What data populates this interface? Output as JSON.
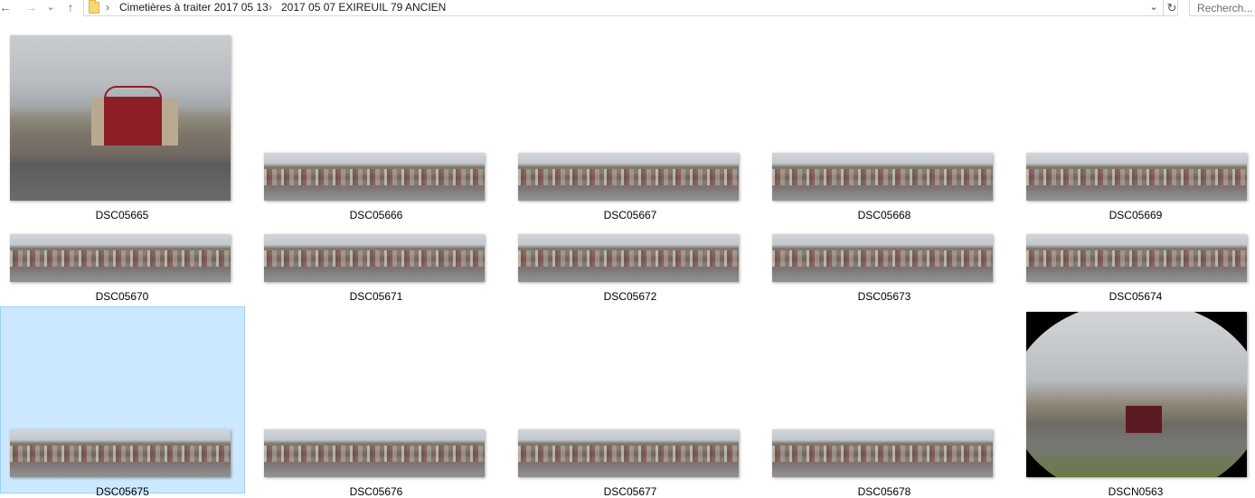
{
  "toolbar": {
    "back_icon": "←",
    "forward_icon": "→",
    "history_icon": "⌄",
    "up_icon": "↑",
    "crumb_sep": "›",
    "breadcrumb": [
      "Cimetières à traiter 2017 05 13",
      "2017 05 07 EXIREUIL 79 ANCIEN"
    ],
    "dropdown_icon": "⌄",
    "refresh_icon": "↻",
    "search_placeholder": "Recherch..."
  },
  "items": [
    {
      "name": "DSC05665",
      "kind": "photo-gate"
    },
    {
      "name": "DSC05666",
      "kind": "pano"
    },
    {
      "name": "DSC05667",
      "kind": "pano"
    },
    {
      "name": "DSC05668",
      "kind": "pano"
    },
    {
      "name": "DSC05669",
      "kind": "pano"
    },
    {
      "name": "DSC05670",
      "kind": "pano"
    },
    {
      "name": "DSC05671",
      "kind": "pano"
    },
    {
      "name": "DSC05672",
      "kind": "pano"
    },
    {
      "name": "DSC05673",
      "kind": "pano"
    },
    {
      "name": "DSC05674",
      "kind": "pano"
    },
    {
      "name": "DSC05675",
      "kind": "pano",
      "selected": true
    },
    {
      "name": "DSC05676",
      "kind": "pano"
    },
    {
      "name": "DSC05677",
      "kind": "pano"
    },
    {
      "name": "DSC05678",
      "kind": "pano"
    },
    {
      "name": "DSCN0563",
      "kind": "fisheye"
    }
  ],
  "colors": {
    "selection_fill": "#cce8ff",
    "selection_border": "#99d1ff",
    "gate_red": "#8d1e28"
  }
}
